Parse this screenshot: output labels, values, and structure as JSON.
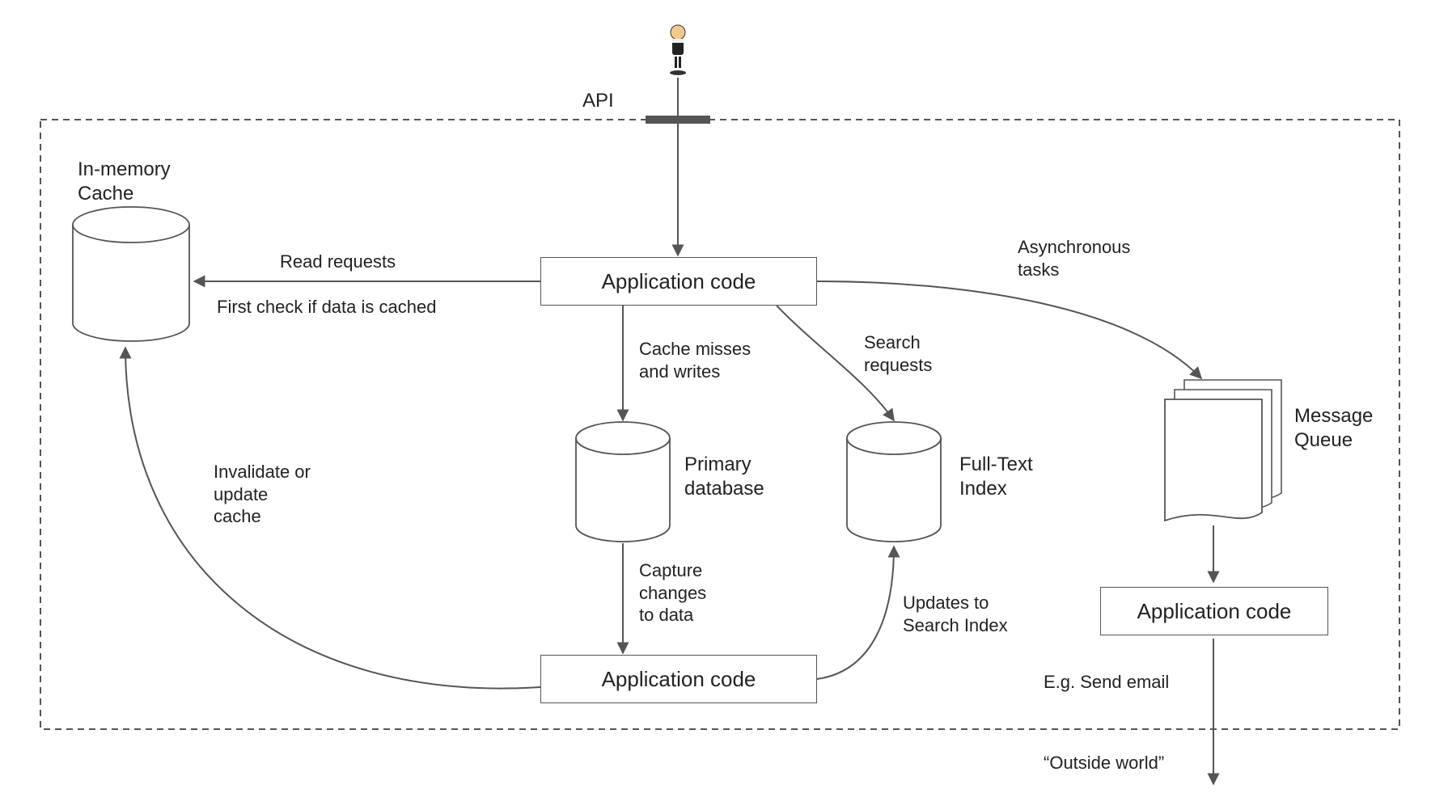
{
  "diagram": {
    "type": "architecture-flow",
    "boundary_label": "API",
    "actor": "user",
    "nodes": {
      "cache": {
        "kind": "cylinder",
        "label": "In-memory\nCache"
      },
      "app_code_top": {
        "kind": "box",
        "label": "Application code"
      },
      "primary_db": {
        "kind": "cylinder",
        "label": "Primary\ndatabase"
      },
      "fulltext_index": {
        "kind": "cylinder",
        "label": "Full-Text\nIndex"
      },
      "message_queue": {
        "kind": "docstack",
        "label": "Message\nQueue"
      },
      "app_code_mid": {
        "kind": "box",
        "label": "Application code"
      },
      "app_code_right": {
        "kind": "box",
        "label": "Application code"
      }
    },
    "edges": [
      {
        "from": "actor",
        "to": "app_code_top",
        "label": ""
      },
      {
        "from": "app_code_top",
        "to": "cache",
        "label": "Read requests\nFirst check if data is cached"
      },
      {
        "from": "app_code_top",
        "to": "primary_db",
        "label": "Cache misses\nand writes"
      },
      {
        "from": "app_code_top",
        "to": "fulltext_index",
        "label": "Search\nrequests"
      },
      {
        "from": "app_code_top",
        "to": "message_queue",
        "label": "Asynchronous\ntasks"
      },
      {
        "from": "primary_db",
        "to": "app_code_mid",
        "label": "Capture\nchanges\nto data"
      },
      {
        "from": "app_code_mid",
        "to": "cache",
        "label": "Invalidate or\nupdate\ncache"
      },
      {
        "from": "app_code_mid",
        "to": "fulltext_index",
        "label": "Updates to\nSearch Index"
      },
      {
        "from": "message_queue",
        "to": "app_code_right",
        "label": ""
      },
      {
        "from": "app_code_right",
        "to": "outside_world",
        "label": "E.g. Send email"
      }
    ],
    "outside_world_label": "“Outside world”"
  },
  "labels": {
    "api": "API",
    "in_memory_cache": "In-memory\nCache",
    "app_code": "Application code",
    "primary_db": "Primary\ndatabase",
    "fulltext_index": "Full-Text\nIndex",
    "message_queue": "Message\nQueue",
    "read_requests": "Read requests",
    "first_check_cached": "First check if data is cached",
    "cache_misses": "Cache misses\nand writes",
    "search_requests": "Search\nrequests",
    "async_tasks": "Asynchronous\ntasks",
    "capture_changes": "Capture\nchanges\nto data",
    "invalidate_cache": "Invalidate or\nupdate\ncache",
    "updates_search": "Updates to\nSearch Index",
    "send_email": "E.g. Send email",
    "outside_world": "“Outside world”"
  }
}
